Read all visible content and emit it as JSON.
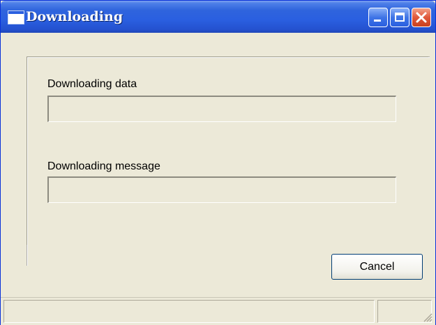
{
  "window": {
    "title": "Downloading",
    "controls": {
      "minimize": "minimize",
      "maximize": "maximize",
      "close": "close"
    }
  },
  "dialog": {
    "data_label": "Downloading data",
    "data_progress_percent": 0,
    "message_label": "Downloading message",
    "message_progress_percent": 0,
    "cancel_label": "Cancel"
  },
  "status_bar": {
    "main_text": "",
    "secondary_text": ""
  },
  "colors": {
    "titlebar": "#2a5fe0",
    "close": "#e0583a",
    "face": "#ece9d8"
  },
  "icons": [
    "app-window-icon",
    "minimize-icon",
    "maximize-icon",
    "close-icon",
    "resize-grip-icon"
  ]
}
